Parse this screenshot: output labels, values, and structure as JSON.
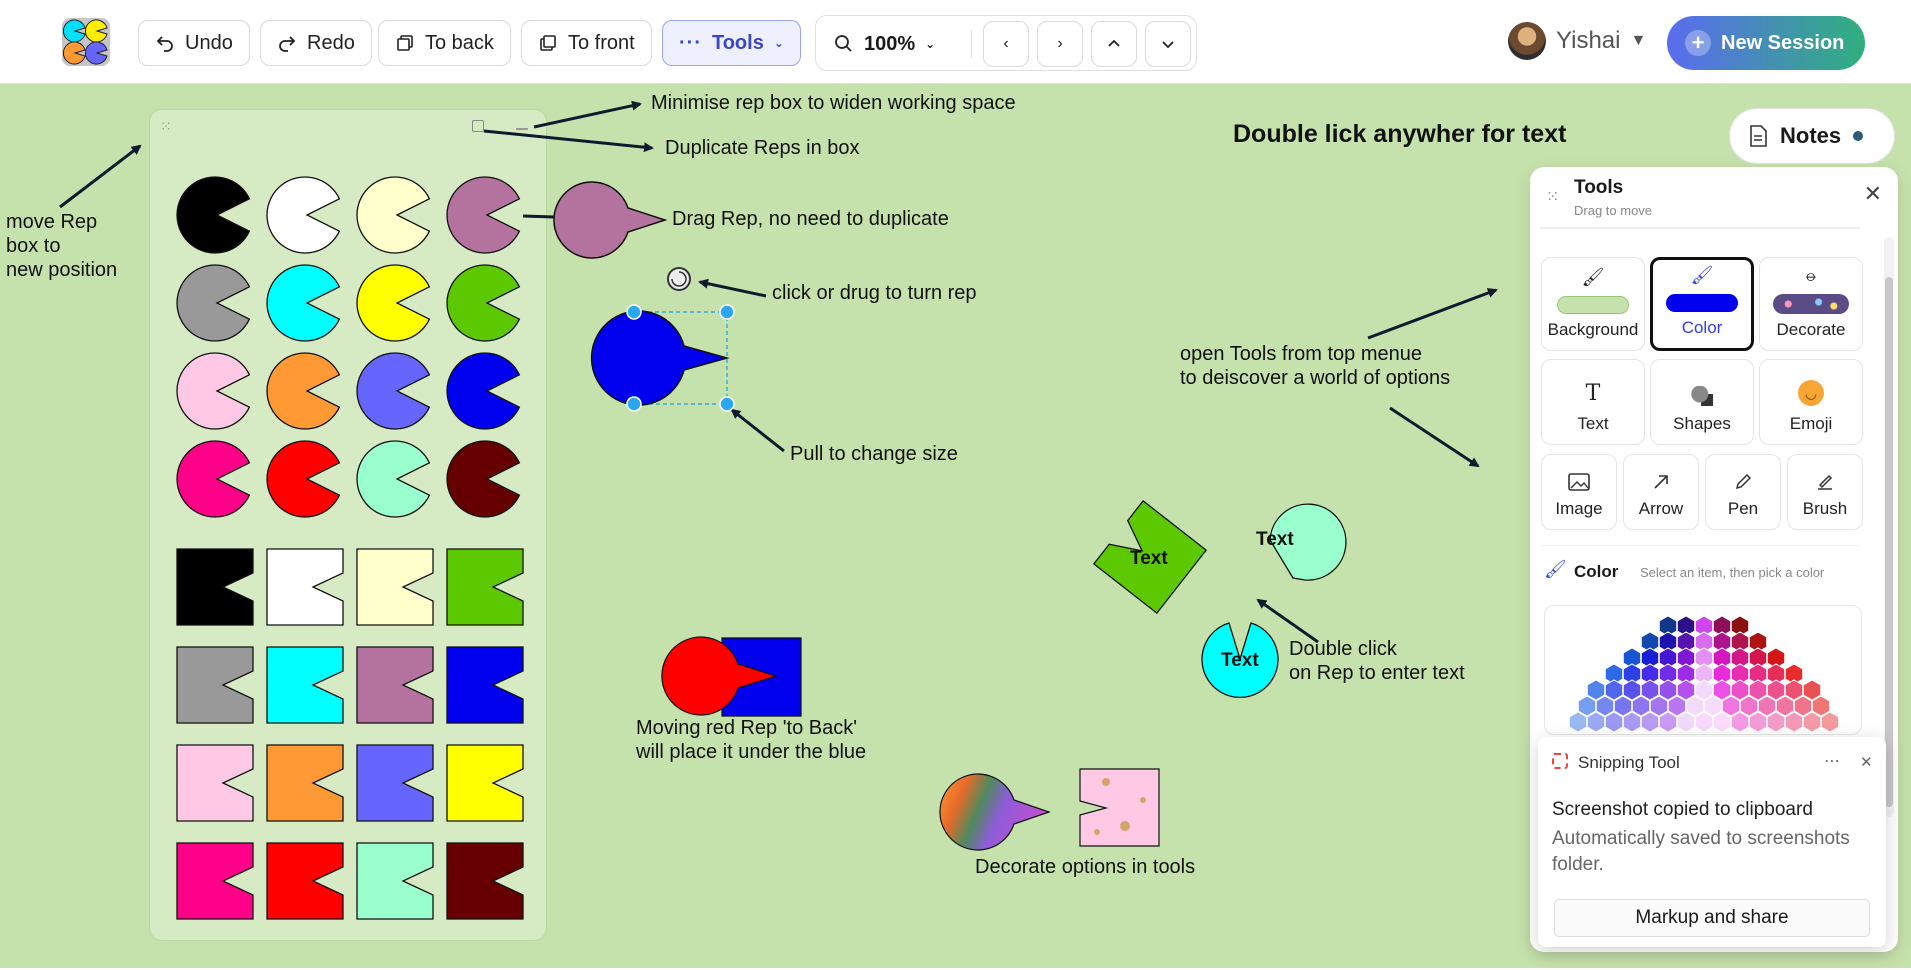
{
  "toolbar": {
    "undo": "Undo",
    "redo": "Redo",
    "to_back": "To back",
    "to_front": "To front",
    "tools": "Tools",
    "zoom": "100%"
  },
  "user": {
    "name": "Yishai"
  },
  "new_session": "New Session",
  "notes": "Notes",
  "canvas": {
    "heading": "Double lick anywher for text",
    "hints": {
      "minimise": "Minimise rep box to widen working space",
      "duplicate": "Duplicate Reps in box",
      "move1": "move Rep",
      "move2": "box to",
      "move3": "new position",
      "drag": "Drag Rep, no need to duplicate",
      "turn": "click or drug to turn rep",
      "pull": "Pull to change size",
      "open1": "open Tools from top menue",
      "open2": "to deiscover a world of options",
      "dbl1": "Double click",
      "dbl2": "on Rep to enter text",
      "back1": "Moving red Rep 'to Back'",
      "back2": "will place it under the blue",
      "decorate": "Decorate options in tools"
    },
    "rep_text": "Text"
  },
  "rep_colors": {
    "circles": [
      "#000000",
      "#ffffff",
      "#ffffcc",
      "#b4729f",
      "#999999",
      "#00ffff",
      "#ffff00",
      "#5cc800",
      "#ffc8e4",
      "#ff9933",
      "#6666ff",
      "#0000ee",
      "#ff0088",
      "#ff0000",
      "#99ffcc",
      "#660000"
    ],
    "squares": [
      "#000000",
      "#ffffff",
      "#ffffcc",
      "#5cc800",
      "#999999",
      "#00ffff",
      "#b4729f",
      "#0000ee",
      "#ffc8e4",
      "#ff9933",
      "#6666ff",
      "#ffff00",
      "#ff0088",
      "#ff0000",
      "#99ffcc",
      "#660000"
    ]
  },
  "tools_panel": {
    "title": "Tools",
    "subtitle": "Drag to move",
    "row1": [
      "Background",
      "Color",
      "Decorate"
    ],
    "row2": [
      "Text",
      "Shapes",
      "Emoji"
    ],
    "row3": [
      "Image",
      "Arrow",
      "Pen",
      "Brush"
    ],
    "color_label": "Color",
    "color_hint": "Select an item, then pick a color"
  },
  "snipping": {
    "app": "Snipping Tool",
    "title": "Screenshot copied to clipboard",
    "desc": "Automatically saved to screenshots folder.",
    "button": "Markup and share"
  }
}
